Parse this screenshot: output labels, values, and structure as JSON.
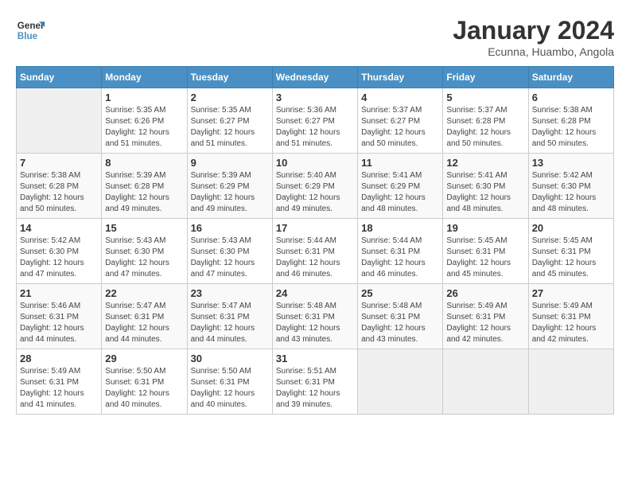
{
  "header": {
    "logo_line1": "General",
    "logo_line2": "Blue",
    "month_title": "January 2024",
    "subtitle": "Ecunna, Huambo, Angola"
  },
  "days_of_week": [
    "Sunday",
    "Monday",
    "Tuesday",
    "Wednesday",
    "Thursday",
    "Friday",
    "Saturday"
  ],
  "weeks": [
    [
      {
        "day": "",
        "sunrise": "",
        "sunset": "",
        "daylight": ""
      },
      {
        "day": "1",
        "sunrise": "Sunrise: 5:35 AM",
        "sunset": "Sunset: 6:26 PM",
        "daylight": "Daylight: 12 hours and 51 minutes."
      },
      {
        "day": "2",
        "sunrise": "Sunrise: 5:35 AM",
        "sunset": "Sunset: 6:27 PM",
        "daylight": "Daylight: 12 hours and 51 minutes."
      },
      {
        "day": "3",
        "sunrise": "Sunrise: 5:36 AM",
        "sunset": "Sunset: 6:27 PM",
        "daylight": "Daylight: 12 hours and 51 minutes."
      },
      {
        "day": "4",
        "sunrise": "Sunrise: 5:37 AM",
        "sunset": "Sunset: 6:27 PM",
        "daylight": "Daylight: 12 hours and 50 minutes."
      },
      {
        "day": "5",
        "sunrise": "Sunrise: 5:37 AM",
        "sunset": "Sunset: 6:28 PM",
        "daylight": "Daylight: 12 hours and 50 minutes."
      },
      {
        "day": "6",
        "sunrise": "Sunrise: 5:38 AM",
        "sunset": "Sunset: 6:28 PM",
        "daylight": "Daylight: 12 hours and 50 minutes."
      }
    ],
    [
      {
        "day": "7",
        "sunrise": "Sunrise: 5:38 AM",
        "sunset": "Sunset: 6:28 PM",
        "daylight": "Daylight: 12 hours and 50 minutes."
      },
      {
        "day": "8",
        "sunrise": "Sunrise: 5:39 AM",
        "sunset": "Sunset: 6:28 PM",
        "daylight": "Daylight: 12 hours and 49 minutes."
      },
      {
        "day": "9",
        "sunrise": "Sunrise: 5:39 AM",
        "sunset": "Sunset: 6:29 PM",
        "daylight": "Daylight: 12 hours and 49 minutes."
      },
      {
        "day": "10",
        "sunrise": "Sunrise: 5:40 AM",
        "sunset": "Sunset: 6:29 PM",
        "daylight": "Daylight: 12 hours and 49 minutes."
      },
      {
        "day": "11",
        "sunrise": "Sunrise: 5:41 AM",
        "sunset": "Sunset: 6:29 PM",
        "daylight": "Daylight: 12 hours and 48 minutes."
      },
      {
        "day": "12",
        "sunrise": "Sunrise: 5:41 AM",
        "sunset": "Sunset: 6:30 PM",
        "daylight": "Daylight: 12 hours and 48 minutes."
      },
      {
        "day": "13",
        "sunrise": "Sunrise: 5:42 AM",
        "sunset": "Sunset: 6:30 PM",
        "daylight": "Daylight: 12 hours and 48 minutes."
      }
    ],
    [
      {
        "day": "14",
        "sunrise": "Sunrise: 5:42 AM",
        "sunset": "Sunset: 6:30 PM",
        "daylight": "Daylight: 12 hours and 47 minutes."
      },
      {
        "day": "15",
        "sunrise": "Sunrise: 5:43 AM",
        "sunset": "Sunset: 6:30 PM",
        "daylight": "Daylight: 12 hours and 47 minutes."
      },
      {
        "day": "16",
        "sunrise": "Sunrise: 5:43 AM",
        "sunset": "Sunset: 6:30 PM",
        "daylight": "Daylight: 12 hours and 47 minutes."
      },
      {
        "day": "17",
        "sunrise": "Sunrise: 5:44 AM",
        "sunset": "Sunset: 6:31 PM",
        "daylight": "Daylight: 12 hours and 46 minutes."
      },
      {
        "day": "18",
        "sunrise": "Sunrise: 5:44 AM",
        "sunset": "Sunset: 6:31 PM",
        "daylight": "Daylight: 12 hours and 46 minutes."
      },
      {
        "day": "19",
        "sunrise": "Sunrise: 5:45 AM",
        "sunset": "Sunset: 6:31 PM",
        "daylight": "Daylight: 12 hours and 45 minutes."
      },
      {
        "day": "20",
        "sunrise": "Sunrise: 5:45 AM",
        "sunset": "Sunset: 6:31 PM",
        "daylight": "Daylight: 12 hours and 45 minutes."
      }
    ],
    [
      {
        "day": "21",
        "sunrise": "Sunrise: 5:46 AM",
        "sunset": "Sunset: 6:31 PM",
        "daylight": "Daylight: 12 hours and 44 minutes."
      },
      {
        "day": "22",
        "sunrise": "Sunrise: 5:47 AM",
        "sunset": "Sunset: 6:31 PM",
        "daylight": "Daylight: 12 hours and 44 minutes."
      },
      {
        "day": "23",
        "sunrise": "Sunrise: 5:47 AM",
        "sunset": "Sunset: 6:31 PM",
        "daylight": "Daylight: 12 hours and 44 minutes."
      },
      {
        "day": "24",
        "sunrise": "Sunrise: 5:48 AM",
        "sunset": "Sunset: 6:31 PM",
        "daylight": "Daylight: 12 hours and 43 minutes."
      },
      {
        "day": "25",
        "sunrise": "Sunrise: 5:48 AM",
        "sunset": "Sunset: 6:31 PM",
        "daylight": "Daylight: 12 hours and 43 minutes."
      },
      {
        "day": "26",
        "sunrise": "Sunrise: 5:49 AM",
        "sunset": "Sunset: 6:31 PM",
        "daylight": "Daylight: 12 hours and 42 minutes."
      },
      {
        "day": "27",
        "sunrise": "Sunrise: 5:49 AM",
        "sunset": "Sunset: 6:31 PM",
        "daylight": "Daylight: 12 hours and 42 minutes."
      }
    ],
    [
      {
        "day": "28",
        "sunrise": "Sunrise: 5:49 AM",
        "sunset": "Sunset: 6:31 PM",
        "daylight": "Daylight: 12 hours and 41 minutes."
      },
      {
        "day": "29",
        "sunrise": "Sunrise: 5:50 AM",
        "sunset": "Sunset: 6:31 PM",
        "daylight": "Daylight: 12 hours and 40 minutes."
      },
      {
        "day": "30",
        "sunrise": "Sunrise: 5:50 AM",
        "sunset": "Sunset: 6:31 PM",
        "daylight": "Daylight: 12 hours and 40 minutes."
      },
      {
        "day": "31",
        "sunrise": "Sunrise: 5:51 AM",
        "sunset": "Sunset: 6:31 PM",
        "daylight": "Daylight: 12 hours and 39 minutes."
      },
      {
        "day": "",
        "sunrise": "",
        "sunset": "",
        "daylight": ""
      },
      {
        "day": "",
        "sunrise": "",
        "sunset": "",
        "daylight": ""
      },
      {
        "day": "",
        "sunrise": "",
        "sunset": "",
        "daylight": ""
      }
    ]
  ]
}
